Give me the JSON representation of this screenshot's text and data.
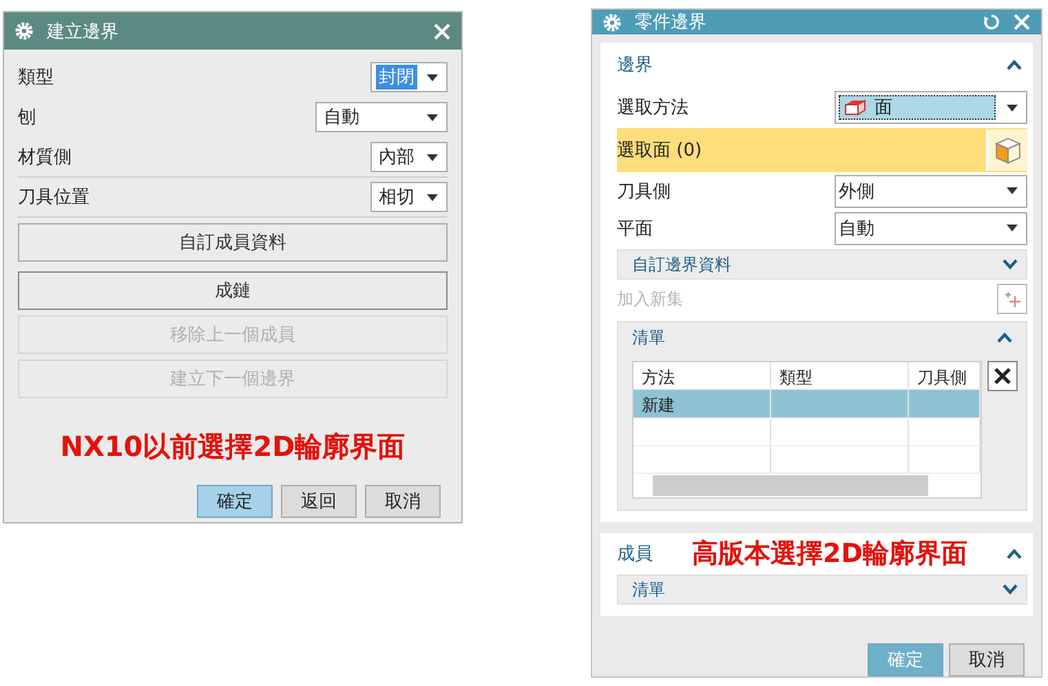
{
  "left_dialog": {
    "title": "建立邊界",
    "fields": [
      {
        "label": "類型",
        "value": "封閉",
        "kind": "compact",
        "value_selected": true
      },
      {
        "label": "刨",
        "value": "自動",
        "kind": "wide",
        "value_selected": false
      },
      {
        "label": "材質側",
        "value": "內部",
        "kind": "compact",
        "value_selected": false
      },
      {
        "label": "刀具位置",
        "value": "相切",
        "kind": "compact",
        "value_selected": false
      }
    ],
    "buttons": [
      {
        "label": "自訂成員資料",
        "disabled": false,
        "focused": false
      },
      {
        "label": "成鏈",
        "disabled": false,
        "focused": true
      },
      {
        "label": "移除上一個成員",
        "disabled": true,
        "focused": false
      },
      {
        "label": "建立下一個邊界",
        "disabled": true,
        "focused": false
      }
    ],
    "annotation": "NX10以前選擇2D輪廓界面",
    "footer_buttons": [
      {
        "label": "確定",
        "default": true
      },
      {
        "label": "返回",
        "default": false
      },
      {
        "label": "取消",
        "default": false
      }
    ]
  },
  "right_dialog": {
    "title": "零件邊界",
    "boundary_section": {
      "title": "邊界",
      "expanded": true,
      "select_method": {
        "label": "選取方法",
        "value": "面"
      },
      "selection": {
        "label": "選取面 (0)",
        "active": true
      },
      "fields": [
        {
          "label": "刀具側",
          "value": "外側"
        },
        {
          "label": "平面",
          "value": "自動"
        }
      ],
      "custom_data": {
        "title": "自訂邊界資料",
        "expanded": false
      },
      "add_set": {
        "label": "加入新集",
        "disabled": true
      },
      "list": {
        "title": "清單",
        "expanded": true,
        "columns": [
          "方法",
          "類型",
          "刀具側"
        ],
        "rows": [
          {
            "cells": [
              "新建"
            ],
            "selected": true
          }
        ]
      }
    },
    "members_section": {
      "title": "成員",
      "expanded": true,
      "annotation": "高版本選擇2D輪廓界面",
      "list": {
        "title": "清單",
        "expanded": false
      }
    },
    "footer_buttons": [
      {
        "label": "確定",
        "default": true
      },
      {
        "label": "取消",
        "default": false
      }
    ]
  }
}
